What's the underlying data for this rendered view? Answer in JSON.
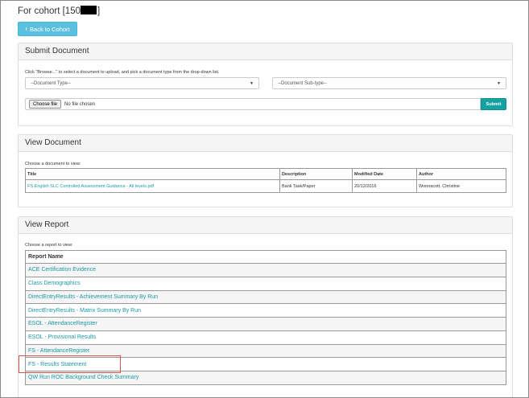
{
  "header": {
    "cohort_prefix": "For cohort [150",
    "cohort_suffix": "]",
    "back_label": "Back to Cohort"
  },
  "submit_panel": {
    "title": "Submit Document",
    "hint": "Click \"Browse...\" to select a document to upload, and pick a document type from the drop-down list.",
    "doc_type": "--Document Type--",
    "doc_subtype": "--Document Sub-type--",
    "choose_file": "Choose file",
    "no_file": "No file chosen",
    "submit": "Submit"
  },
  "view_panel": {
    "title": "View Document",
    "hint": "Choose a document to view:",
    "columns": [
      "Title",
      "Description",
      "Modified Date",
      "Author"
    ],
    "rows": [
      {
        "title": "FS English SLC Controlled Assessment Guidance - All levels.pdf",
        "description": "Bank Task/Paper",
        "modified": "20/12/2016",
        "author": "Wonnacott, Christine"
      }
    ]
  },
  "report_panel": {
    "title": "View Report",
    "hint": "Choose a report to view:",
    "column": "Report Name",
    "reports": [
      "ACE Certification Evidence",
      "Class Demographics",
      "DirectEntryResults - Achievement Summary By Run",
      "DirectEntryResults - Matrix Summary By Run",
      "ESOL - AttendanceRegister",
      "ESOL - Provisional Results",
      "FS - AttendanceRegister",
      "FS - Results Statement",
      "QW Run ROC Background Check Summary"
    ],
    "highlighted_index": 7
  },
  "colors": {
    "link": "#1a9aa3",
    "back_button": "#5bc0de",
    "submit_button": "#17a2a2",
    "highlight_box": "#d9534f"
  }
}
